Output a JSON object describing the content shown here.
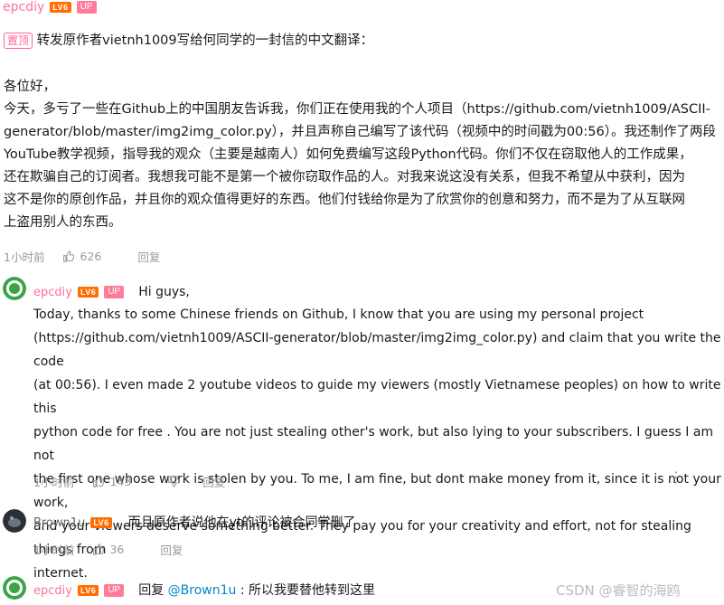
{
  "pinned_comment": {
    "user": "epcdiy",
    "level": "LV6",
    "up_badge": "UP",
    "pinned_label": "置顶",
    "first_line": "转发原作者vietnh1009写给何同学的一封信的中文翻译：",
    "lines": [
      "各位好，",
      "今天，多亏了一些在Github上的中国朋友告诉我，你们正在使用我的个人项目（https://github.com/vietnh1009/ASCII-",
      "generator/blob/master/img2img_color.py），并且声称自己编写了该代码（视频中的时间戳为00:56）。我还制作了两段",
      "YouTube教学视频，指导我的观众（主要是越南人）如何免费编写这段Python代码。你们不仅在窃取他人的工作成果，",
      "还在欺骗自己的订阅者。我想我可能不是第一个被你窃取作品的人。对我来说这没有关系，但我不希望从中获利，因为",
      "这不是你的原创作品，并且你的观众值得更好的东西。他们付钱给你是为了欣赏你的创意和努力，而不是为了从互联网",
      "上盗用别人的东西。"
    ],
    "time": "1小时前",
    "likes": "626",
    "reply_label": "回复"
  },
  "reply1": {
    "user": "epcdiy",
    "level": "LV6",
    "up_badge": "UP",
    "first_line": "Hi guys,",
    "lines": [
      "Today, thanks to some Chinese friends on Github, I know that you are using my personal project",
      "(https://github.com/vietnh1009/ASCII-generator/blob/master/img2img_color.py) and claim that you write the code",
      "(at 00:56). I even made 2 youtube videos to guide my viewers (mostly Vietnamese peoples) on how to write this",
      "python code for free . You are not just stealing other's work, but also lying to your subscribers. I guess I am not",
      "the first one whose work is stolen by you. To me, I am fine, but dont make money from it, since it is not your work,",
      "and your viewers deserve something better. They pay you for your creativity and effort, not for stealing things from",
      "internet."
    ],
    "time": "1小时前",
    "likes": "143",
    "reply_label": "回复",
    "more": "⋮"
  },
  "reply2": {
    "user": "Brown1u",
    "level": "LV6",
    "text": "而且原作者说他在yt的评论被合同学删了",
    "time": "1小时前",
    "likes": "36",
    "reply_label": "回复"
  },
  "reply3": {
    "user": "epcdiy",
    "level": "LV6",
    "up_badge": "UP",
    "reply_prefix": "回复",
    "mention": "@Brown1u",
    "text": " : 所以我要替他转到这里"
  },
  "watermark": "CSDN @睿智的海鸥",
  "colors": {
    "username": "#fb7299",
    "level": "#ff6c00",
    "up": "#ff7b98",
    "meta": "#9499a0",
    "mention": "#008ac5"
  }
}
